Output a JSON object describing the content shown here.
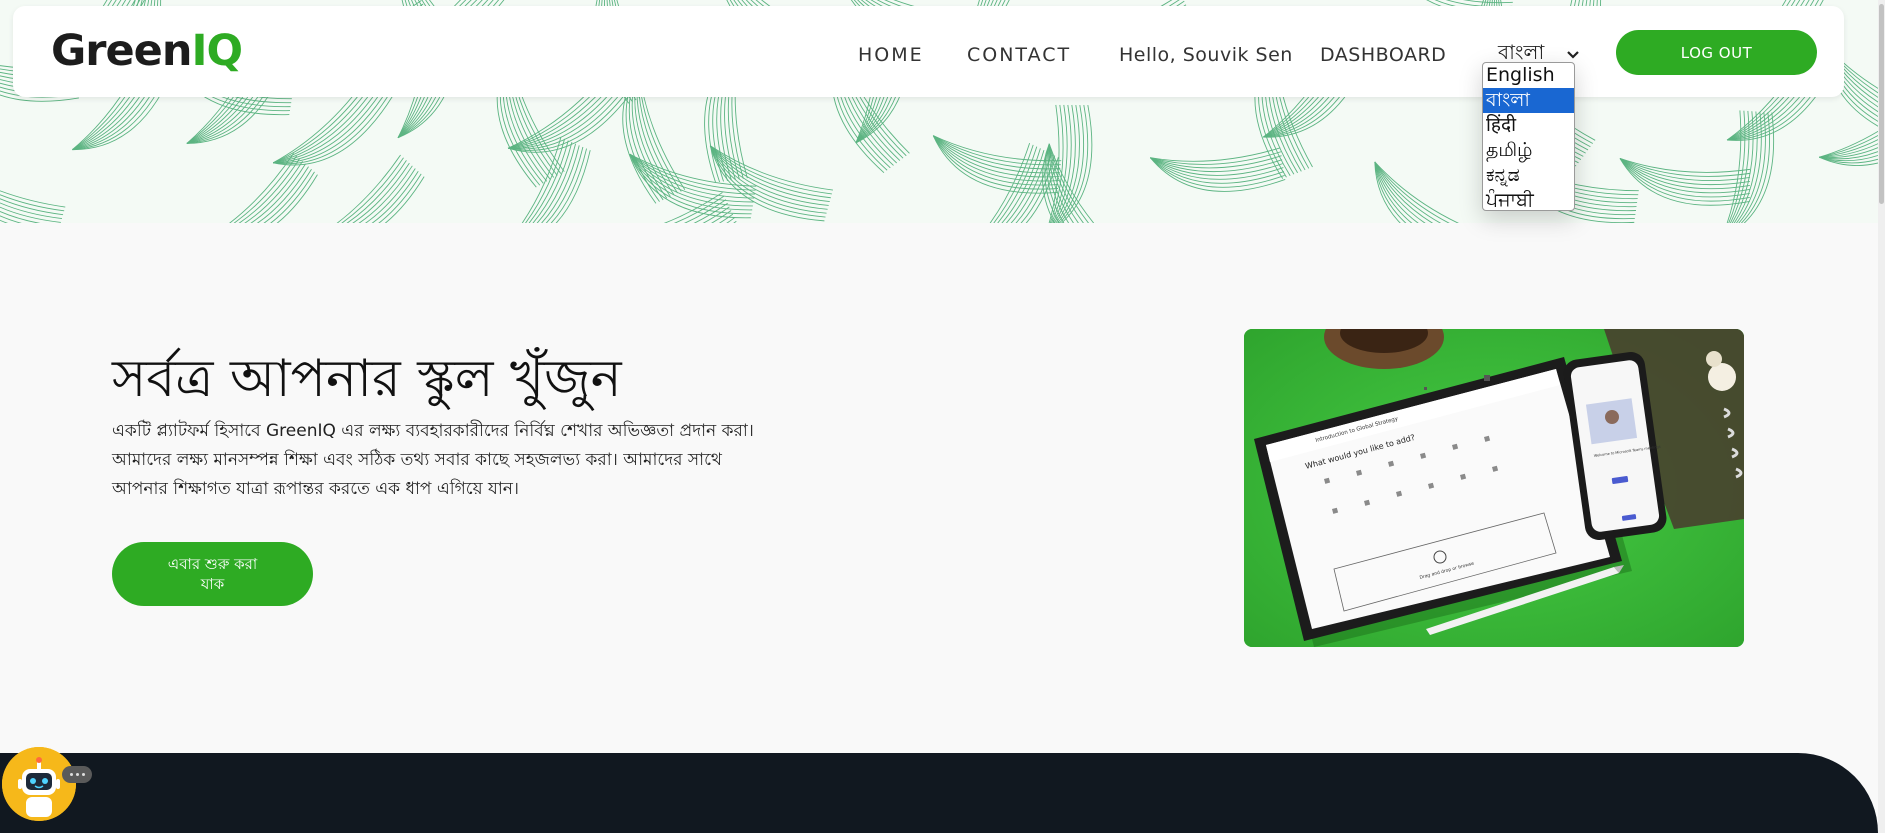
{
  "colors": {
    "brand_green": "#2eab23",
    "footer_dark": "#111820",
    "select_blue": "#1967d2",
    "pattern_green": "#2a9d5c"
  },
  "navbar": {
    "logo_main": "Green",
    "logo_accent": "IQ",
    "links": {
      "home": "HOME",
      "contact": "CONTACT",
      "hello": "Hello, Souvik Sen",
      "dashboard": "DASHBOARD"
    },
    "language": {
      "selected": "বাংলা",
      "options": [
        "English",
        "বাংলা",
        "हिंदी",
        "தமிழ்",
        "ಕನ್ನಡ",
        "ਪੰਜਾਬੀ"
      ]
    },
    "logout_label": "LOG OUT"
  },
  "hero": {
    "title": "সর্বত্র আপনার স্কুল খুঁজুন",
    "description": "একটি প্ল্যাটফর্ম হিসাবে GreenIQ এর লক্ষ্য ব্যবহারকারীদের নির্বিঘ্ন শেখার অভিজ্ঞতা প্রদান করা। আমাদের লক্ষ্য মানসম্পন্ন শিক্ষা এবং সঠিক তথ্য সবার কাছে সহজলভ্য করা। আমাদের সাথে আপনার শিক্ষাগত যাত্রা রূপান্তর করতে এক ধাপ এগিয়ে যান।",
    "cta_label": "এবার শুরু করা যাক"
  },
  "tablet_screen": {
    "course_title": "Introduction to Global Strategy",
    "prompt": "What would you like to add?",
    "drop_text": "Drag and drop or browse"
  },
  "phone_screen": {
    "welcome": "Welcome to Microsoft Teams meetings"
  },
  "icons": {
    "chevron": "chevron-down-icon",
    "chatbot": "robot-icon",
    "chat_more": "more-icon"
  }
}
